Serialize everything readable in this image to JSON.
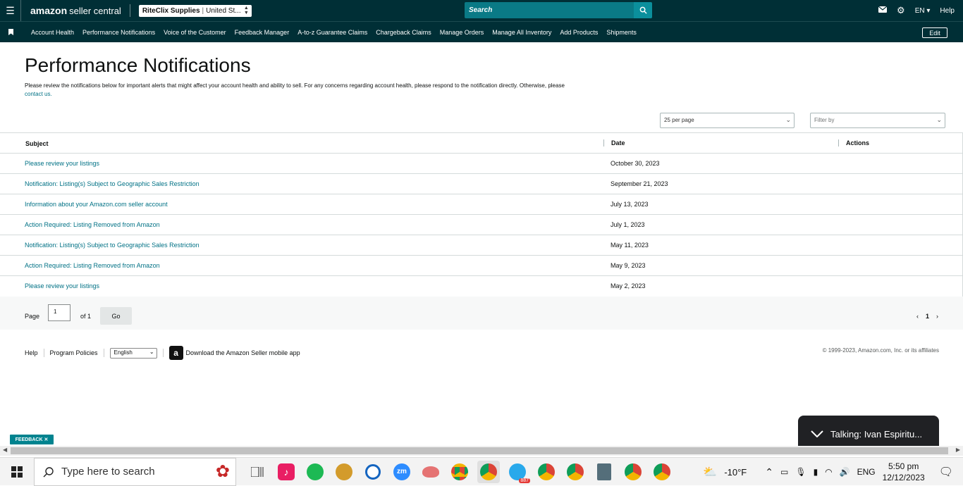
{
  "header": {
    "logo_brand": "amazon",
    "logo_suffix": "seller central",
    "store_name": "RiteClix Supplies",
    "store_region": "United St...",
    "search_placeholder": "Search",
    "lang": "EN",
    "help": "Help"
  },
  "nav": {
    "items": [
      "Account Health",
      "Performance Notifications",
      "Voice of the Customer",
      "Feedback Manager",
      "A-to-z Guarantee Claims",
      "Chargeback Claims",
      "Manage Orders",
      "Manage All Inventory",
      "Add Products",
      "Shipments"
    ],
    "edit": "Edit"
  },
  "page": {
    "title": "Performance Notifications",
    "intro": "Please review the notifications below for important alerts that might affect your account health and ability to sell. For any concerns regarding account health, please respond to the notification directly. Otherwise, please",
    "contact_link": "contact us."
  },
  "controls": {
    "per_page": "25 per page",
    "filter_placeholder": "Filter by"
  },
  "table": {
    "headers": {
      "subject": "Subject",
      "date": "Date",
      "actions": "Actions"
    },
    "rows": [
      {
        "subject": "Please review your listings",
        "date": "October 30, 2023"
      },
      {
        "subject": "Notification: Listing(s) Subject to Geographic Sales Restriction",
        "date": "September 21, 2023"
      },
      {
        "subject": "Information about your Amazon.com seller account",
        "date": "July 13, 2023"
      },
      {
        "subject": "Action Required: Listing Removed from Amazon",
        "date": "July 1, 2023"
      },
      {
        "subject": "Notification: Listing(s) Subject to Geographic Sales Restriction",
        "date": "May 11, 2023"
      },
      {
        "subject": "Action Required: Listing Removed from Amazon",
        "date": "May 9, 2023"
      },
      {
        "subject": "Please review your listings",
        "date": "May 2, 2023"
      }
    ]
  },
  "pager": {
    "label": "Page",
    "value": "1",
    "of": "of 1",
    "go": "Go",
    "current": "1",
    "prev": "‹",
    "next": "›"
  },
  "footer": {
    "help": "Help",
    "policies": "Program Policies",
    "language": "English",
    "app_download": "Download the Amazon Seller mobile app",
    "copyright": "© 1999-2023, Amazon.com, Inc. or its affiliates"
  },
  "feedback": "FEEDBACK ✕",
  "talking": "Talking: Ivan Espiritu...",
  "taskbar": {
    "search_placeholder": "Type here to search",
    "telegram_badge": "887",
    "weather": "-10°F",
    "lang": "ENG",
    "time": "5:50 pm",
    "date": "12/12/2023"
  },
  "colors": {
    "header_bg": "#002f36",
    "search_bg": "#0a7a86",
    "link": "#007185"
  }
}
